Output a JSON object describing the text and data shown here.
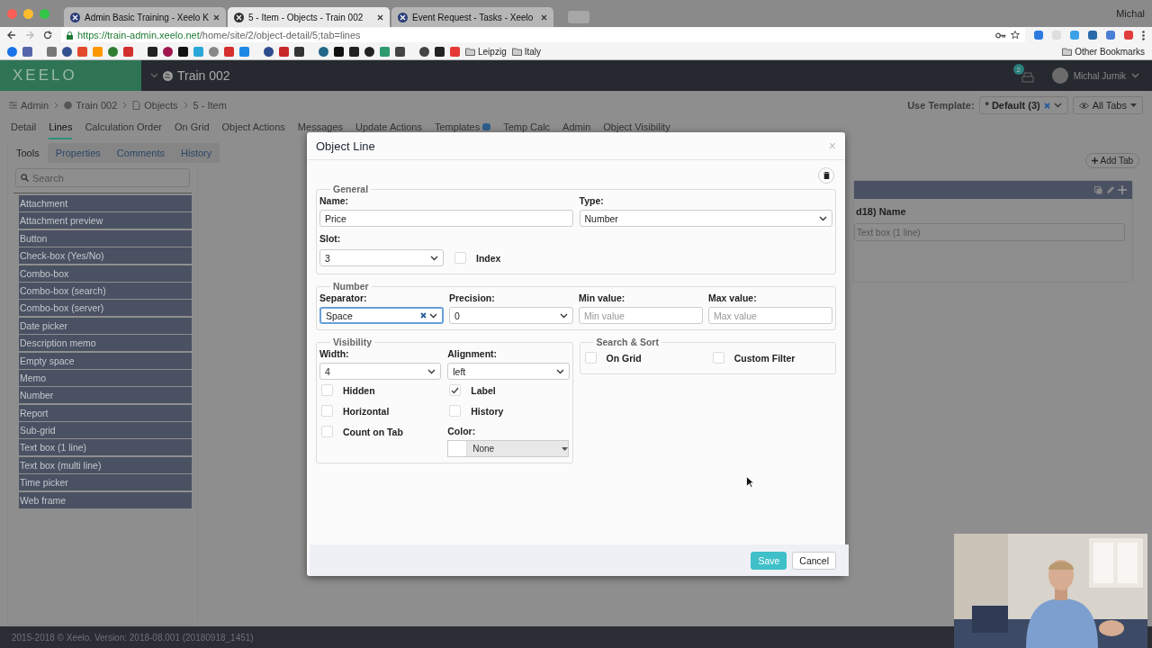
{
  "browser": {
    "tabs": [
      {
        "title": "Admin Basic Training - Xeelo K",
        "selected": false
      },
      {
        "title": "5 - Item - Objects - Train 002",
        "selected": true
      },
      {
        "title": "Event Request - Tasks - Xeelo",
        "selected": false
      }
    ],
    "profile": "Michal",
    "url_host": "https://train-admin.xeelo.net",
    "url_path": "/home/site/2/object-detail/5;tab=lines",
    "bookmarks": [
      "Leipzig",
      "Italy"
    ],
    "other_bookmarks": "Other Bookmarks"
  },
  "header": {
    "logo": "XEELO",
    "site": "Train 002",
    "notifications": "2",
    "user": "Michal Jurnik"
  },
  "breadcrumb": [
    "Admin",
    "Train 002",
    "Objects",
    "5 - Item"
  ],
  "template": {
    "label": "Use Template:",
    "value": "* Default (3)",
    "view": "All Tabs"
  },
  "tabs": [
    {
      "label": "Detail",
      "selected": false
    },
    {
      "label": "Lines",
      "selected": true
    },
    {
      "label": "Calculation Order",
      "selected": false
    },
    {
      "label": "On Grid",
      "selected": false
    },
    {
      "label": "Object Actions",
      "selected": false
    },
    {
      "label": "Messages",
      "selected": false
    },
    {
      "label": "Update Actions",
      "selected": false
    },
    {
      "label": "Templates",
      "selected": false,
      "badge": true
    },
    {
      "label": "Temp Calc",
      "selected": false
    },
    {
      "label": "Admin",
      "selected": false
    },
    {
      "label": "Object Visibility",
      "selected": false
    }
  ],
  "subtabs": [
    {
      "label": "Tools",
      "selected": true
    },
    {
      "label": "Properties",
      "selected": false
    },
    {
      "label": "Comments",
      "selected": false
    },
    {
      "label": "History",
      "selected": false
    }
  ],
  "search": {
    "placeholder": "Search"
  },
  "tools": [
    "Attachment",
    "Attachment preview",
    "Button",
    "Check-box (Yes/No)",
    "Combo-box",
    "Combo-box (search)",
    "Combo-box (server)",
    "Date picker",
    "Description memo",
    "Empty space",
    "Memo",
    "Number",
    "Report",
    "Sub-grid",
    "Text box (1 line)",
    "Text box (multi line)",
    "Time picker",
    "Web frame"
  ],
  "canvas": {
    "add_tab": "Add Tab",
    "field_label": "d18) Name",
    "field_value": "Text box (1 line)"
  },
  "footer": "2015-2018 © Xeelo. Version: 2018-08.001 (20180918_1451)",
  "modal": {
    "title": "Object Line",
    "close": "×",
    "general": {
      "legend": "General",
      "name": {
        "label": "Name:",
        "value": "Price"
      },
      "type": {
        "label": "Type:",
        "value": "Number"
      },
      "slot": {
        "label": "Slot:",
        "value": "3"
      },
      "index": {
        "label": "Index",
        "checked": false
      }
    },
    "number": {
      "legend": "Number",
      "separator": {
        "label": "Separator:",
        "value": "Space",
        "focused": true
      },
      "precision": {
        "label": "Precision:",
        "value": "0"
      },
      "min": {
        "label": "Min value:",
        "placeholder": "Min value"
      },
      "max": {
        "label": "Max value:",
        "placeholder": "Max value"
      }
    },
    "visibility": {
      "legend": "Visibility",
      "width": {
        "label": "Width:",
        "value": "4"
      },
      "alignment": {
        "label": "Alignment:",
        "value": "left"
      },
      "checks": [
        {
          "label": "Hidden",
          "checked": false
        },
        {
          "label": "Label",
          "checked": true
        },
        {
          "label": "Horizontal",
          "checked": false
        },
        {
          "label": "History",
          "checked": false
        },
        {
          "label": "Count on Tab",
          "checked": false
        }
      ],
      "color": {
        "label": "Color:",
        "value": "None"
      }
    },
    "search_sort": {
      "legend": "Search & Sort",
      "checks": [
        {
          "label": "On Grid",
          "checked": false
        },
        {
          "label": "Custom Filter",
          "checked": false
        }
      ]
    },
    "buttons": [
      {
        "label": "Save",
        "kind": "primary"
      },
      {
        "label": "Cancel",
        "kind": "default"
      }
    ]
  }
}
